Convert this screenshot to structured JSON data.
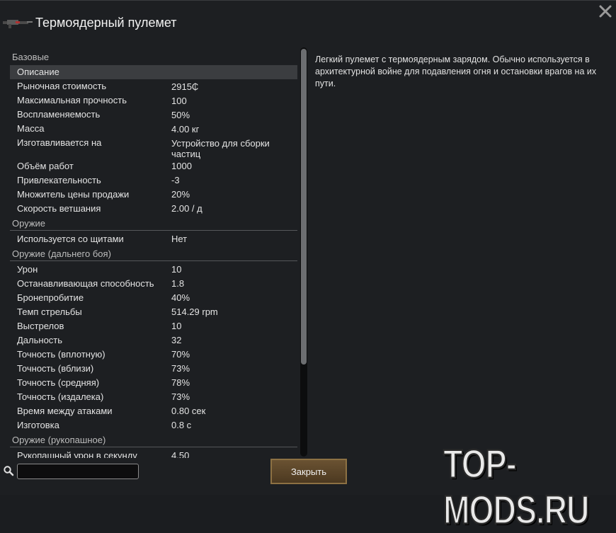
{
  "window": {
    "title": "Термоядерный пулемет"
  },
  "description": "Легкий пулемет с термоядерным зарядом. Обычно используется в архитектурной войне для подавления огня и остановки врагов на их пути.",
  "sections": [
    {
      "name": "Базовые",
      "rows": [
        {
          "label": "Описание",
          "value": "",
          "selected": true
        },
        {
          "label": "Рыночная стоимость",
          "value": "2915₵"
        },
        {
          "label": "Максимальная прочность",
          "value": "100"
        },
        {
          "label": "Воспламеняемость",
          "value": "50%"
        },
        {
          "label": "Масса",
          "value": "4.00 кг"
        },
        {
          "label": "Изготавливается на",
          "value": "Устройство для сборки частиц"
        },
        {
          "label": "Объём работ",
          "value": "1000"
        },
        {
          "label": "Привлекательность",
          "value": "-3"
        },
        {
          "label": "Множитель цены продажи",
          "value": "20%"
        },
        {
          "label": "Скорость ветшания",
          "value": "2.00 / д"
        }
      ]
    },
    {
      "name": "Оружие",
      "rows": [
        {
          "label": "Используется со щитами",
          "value": "Нет"
        }
      ]
    },
    {
      "name": "Оружие (дальнего боя)",
      "rows": [
        {
          "label": "Урон",
          "value": "10"
        },
        {
          "label": "Останавливающая способность",
          "value": "1.8"
        },
        {
          "label": "Бронепробитие",
          "value": "40%"
        },
        {
          "label": "Темп стрельбы",
          "value": "514.29 rpm"
        },
        {
          "label": "Выстрелов",
          "value": "10"
        },
        {
          "label": "Дальность",
          "value": "32"
        },
        {
          "label": "Точность (вплотную)",
          "value": "70%"
        },
        {
          "label": "Точность (вблизи)",
          "value": "73%"
        },
        {
          "label": "Точность (средняя)",
          "value": "78%"
        },
        {
          "label": "Точность (издалека)",
          "value": "73%"
        },
        {
          "label": "Время между атаками",
          "value": "0.80 сек"
        },
        {
          "label": "Изготовка",
          "value": "0.8 с"
        }
      ]
    },
    {
      "name": "Оружие (рукопашное)",
      "rows": [
        {
          "label": "Рукопашный урон в секунду",
          "value": "4.50"
        }
      ]
    }
  ],
  "search": {
    "value": "",
    "placeholder": ""
  },
  "buttons": {
    "close_label": "Закрыть"
  },
  "icons": {
    "close": "close-icon",
    "search": "search-icon",
    "weapon": "weapon-icon"
  },
  "watermark": "TOP-MODS.RU",
  "colors": {
    "background": "#1d1f22",
    "selected_row": "#3b3d40",
    "button": "#5c4629"
  }
}
